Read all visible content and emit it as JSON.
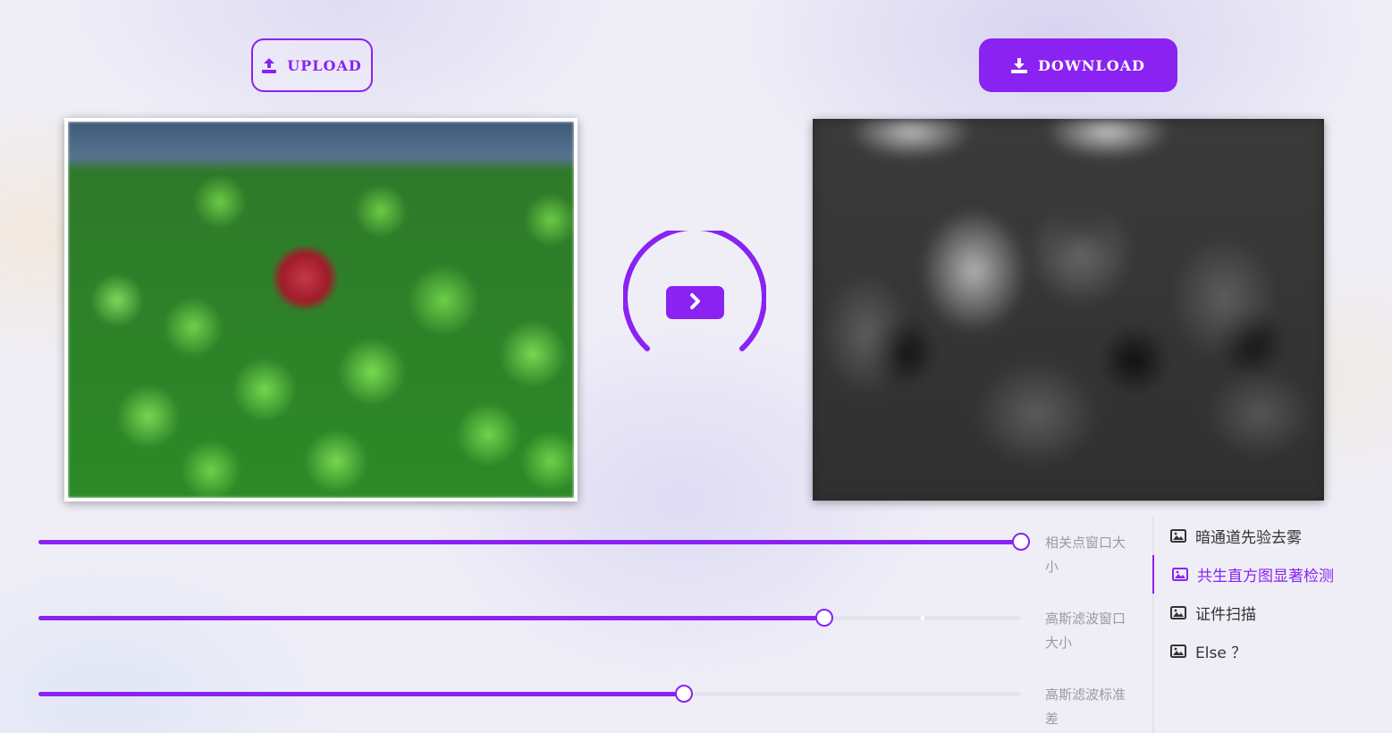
{
  "toolbar": {
    "upload_label": "UPLOAD",
    "download_label": "DOWNLOAD",
    "upload_icon": "upload-icon",
    "download_icon": "download-icon"
  },
  "images": {
    "input_description": "photo",
    "output_description": "saliency map"
  },
  "run_button": {
    "icon": "chevron-right-icon"
  },
  "sliders": [
    {
      "label": "相关点窗口大小",
      "value_fraction": 1.0
    },
    {
      "label": "高斯滤波窗口大小",
      "value_fraction": 0.8,
      "marker_fraction": 0.9
    },
    {
      "label": "高斯滤波标准差",
      "value_fraction": 0.657
    }
  ],
  "menu": {
    "items": [
      {
        "label": "暗通道先验去雾",
        "icon": "image-icon",
        "active": false
      },
      {
        "label": "共生直方图显著检测",
        "icon": "image-icon",
        "active": true
      },
      {
        "label": "证件扫描",
        "icon": "image-icon",
        "active": false
      },
      {
        "label": "Else ？",
        "icon": "image-icon",
        "active": false
      }
    ]
  },
  "colors": {
    "accent": "#8a22f2",
    "label_gray": "#9a9aa2",
    "menu_text": "#333333"
  }
}
